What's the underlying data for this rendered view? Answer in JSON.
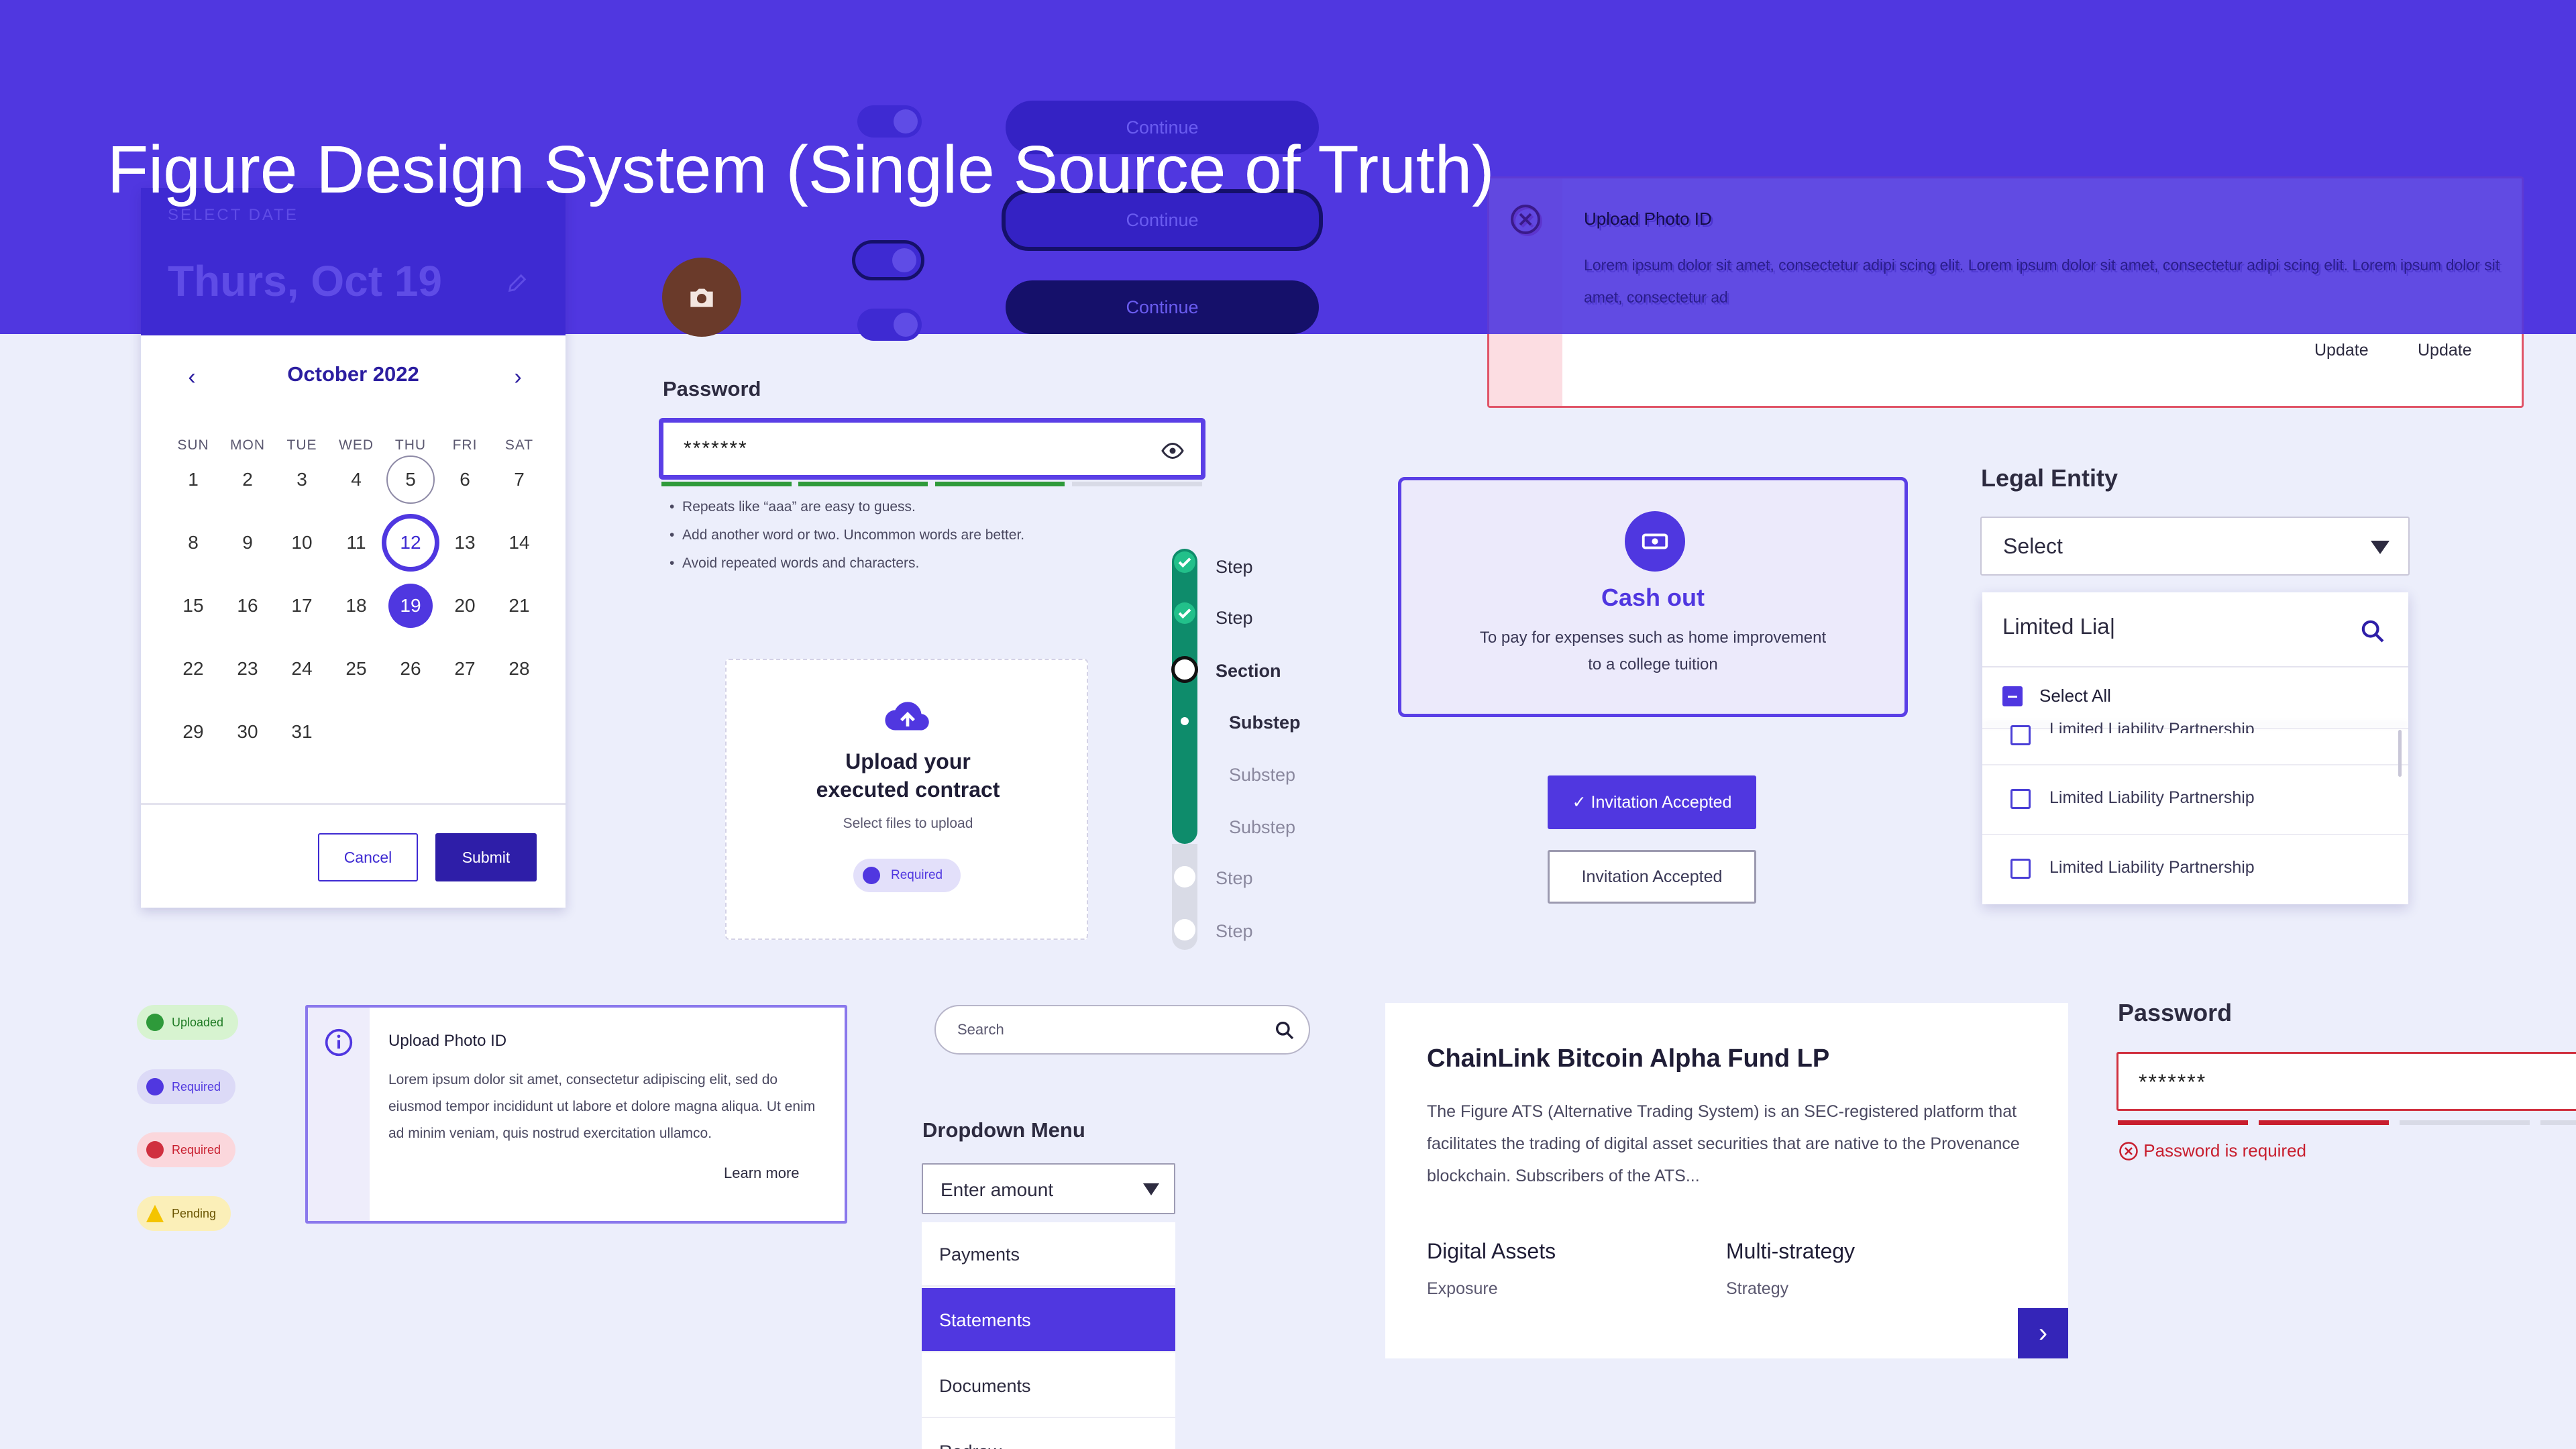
{
  "title": "Figure Design System (Single Source of Truth)",
  "datepicker": {
    "select_label": "SELECT DATE",
    "selected_text": "Thurs, Oct 19",
    "month": "October 2022",
    "prev": "‹",
    "next": "›",
    "weekdays": [
      "SUN",
      "MON",
      "TUE",
      "WED",
      "THU",
      "FRI",
      "SAT"
    ],
    "days": [
      "1",
      "2",
      "3",
      "4",
      "5",
      "6",
      "7",
      "8",
      "9",
      "10",
      "11",
      "12",
      "13",
      "14",
      "15",
      "16",
      "17",
      "18",
      "19",
      "20",
      "21",
      "22",
      "23",
      "24",
      "25",
      "26",
      "27",
      "28",
      "29",
      "30",
      "31"
    ],
    "cancel": "Cancel",
    "submit": "Submit"
  },
  "continue_buttons": [
    "Continue",
    "Continue",
    "Continue"
  ],
  "password": {
    "label": "Password",
    "value": "*******",
    "strength_filled": 3,
    "strength_total": 4,
    "hints": [
      "Repeats like “aaa” are easy to guess.",
      "Add another word or two. Uncommon words are better.",
      "Avoid repeated words and characters."
    ]
  },
  "stepper": {
    "items": [
      "Step",
      "Step",
      "Section",
      "Substep",
      "Substep",
      "Substep",
      "Step",
      "Step"
    ]
  },
  "upload": {
    "title_line1": "Upload your",
    "title_line2": "executed contract",
    "subtitle": "Select files to upload",
    "badge": "Required"
  },
  "alert_error": {
    "title": "Upload Photo ID",
    "body": "Lorem ipsum dolor sit amet, consectetur adipi scing elit. Lorem ipsum dolor sit amet, consectetur adipi scing elit. Lorem ipsum dolor sit amet, consectetur ad",
    "action1": "Update",
    "action2": "Update"
  },
  "cashout": {
    "title": "Cash out",
    "line1": "To pay for expenses such as home improvement",
    "line2": "to a college tuition"
  },
  "invitation": {
    "accepted_primary": "Invitation Accepted",
    "accepted_secondary": "Invitation Accepted"
  },
  "legal_entity": {
    "label": "Legal Entity",
    "select_value": "Select",
    "search_value": "Limited Lia",
    "select_all": "Select All",
    "options": [
      "Limited Liability Partnership",
      "Limited Liability Partnership",
      "Limited Liability Partnership"
    ]
  },
  "status_chips": [
    "Uploaded",
    "Required",
    "Required",
    "Pending"
  ],
  "alert_info": {
    "title": "Upload Photo ID",
    "body": "Lorem ipsum dolor sit amet, consectetur adipiscing elit, sed do eiusmod tempor incididunt ut labore et dolore magna aliqua. Ut enim ad minim veniam, quis nostrud exercitation ullamco.",
    "link": "Learn more"
  },
  "search": {
    "placeholder": "Search"
  },
  "dropdown": {
    "label": "Dropdown Menu",
    "value": "Enter amount",
    "items": [
      "Payments",
      "Statements",
      "Documents",
      "Redraw"
    ],
    "active_index": 1
  },
  "fund": {
    "title": "ChainLink Bitcoin Alpha Fund LP",
    "description": "The Figure ATS (Alternative Trading System) is an SEC-registered platform that facilitates the trading of digital asset securities that are native to the Provenance blockchain. Subscribers of the ATS...",
    "stat1_value": "Digital Assets",
    "stat1_label": "Exposure",
    "stat2_value": "Multi-strategy",
    "stat2_label": "Strategy"
  },
  "password_error": {
    "label": "Password",
    "value": "*******",
    "error": "Password is required"
  },
  "colors": {
    "brand": "#5037e0",
    "success": "#0e8c6b",
    "error": "#d0303f",
    "warning": "#f4c400"
  }
}
